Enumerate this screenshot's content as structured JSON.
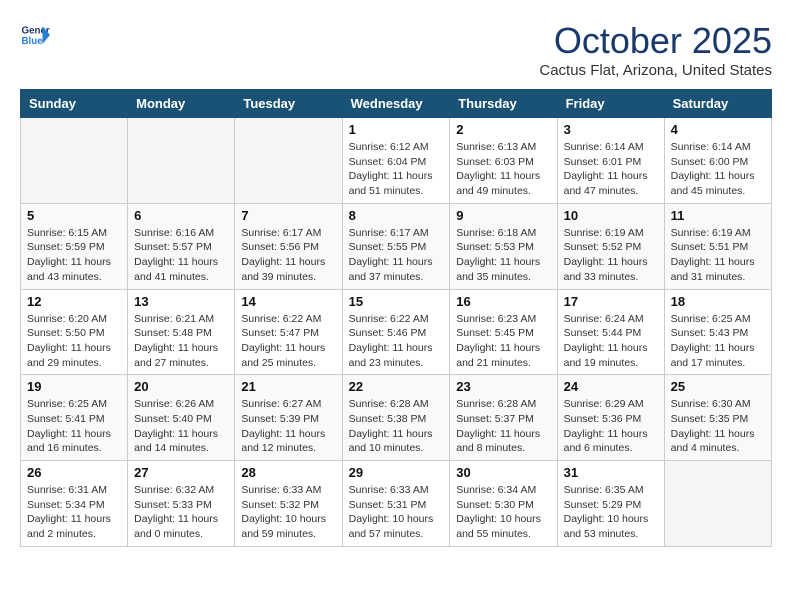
{
  "header": {
    "logo_line1": "General",
    "logo_line2": "Blue",
    "month": "October 2025",
    "location": "Cactus Flat, Arizona, United States"
  },
  "days_of_week": [
    "Sunday",
    "Monday",
    "Tuesday",
    "Wednesday",
    "Thursday",
    "Friday",
    "Saturday"
  ],
  "weeks": [
    [
      {
        "day": "",
        "sunrise": "",
        "sunset": "",
        "daylight": ""
      },
      {
        "day": "",
        "sunrise": "",
        "sunset": "",
        "daylight": ""
      },
      {
        "day": "",
        "sunrise": "",
        "sunset": "",
        "daylight": ""
      },
      {
        "day": "1",
        "sunrise": "Sunrise: 6:12 AM",
        "sunset": "Sunset: 6:04 PM",
        "daylight": "Daylight: 11 hours and 51 minutes."
      },
      {
        "day": "2",
        "sunrise": "Sunrise: 6:13 AM",
        "sunset": "Sunset: 6:03 PM",
        "daylight": "Daylight: 11 hours and 49 minutes."
      },
      {
        "day": "3",
        "sunrise": "Sunrise: 6:14 AM",
        "sunset": "Sunset: 6:01 PM",
        "daylight": "Daylight: 11 hours and 47 minutes."
      },
      {
        "day": "4",
        "sunrise": "Sunrise: 6:14 AM",
        "sunset": "Sunset: 6:00 PM",
        "daylight": "Daylight: 11 hours and 45 minutes."
      }
    ],
    [
      {
        "day": "5",
        "sunrise": "Sunrise: 6:15 AM",
        "sunset": "Sunset: 5:59 PM",
        "daylight": "Daylight: 11 hours and 43 minutes."
      },
      {
        "day": "6",
        "sunrise": "Sunrise: 6:16 AM",
        "sunset": "Sunset: 5:57 PM",
        "daylight": "Daylight: 11 hours and 41 minutes."
      },
      {
        "day": "7",
        "sunrise": "Sunrise: 6:17 AM",
        "sunset": "Sunset: 5:56 PM",
        "daylight": "Daylight: 11 hours and 39 minutes."
      },
      {
        "day": "8",
        "sunrise": "Sunrise: 6:17 AM",
        "sunset": "Sunset: 5:55 PM",
        "daylight": "Daylight: 11 hours and 37 minutes."
      },
      {
        "day": "9",
        "sunrise": "Sunrise: 6:18 AM",
        "sunset": "Sunset: 5:53 PM",
        "daylight": "Daylight: 11 hours and 35 minutes."
      },
      {
        "day": "10",
        "sunrise": "Sunrise: 6:19 AM",
        "sunset": "Sunset: 5:52 PM",
        "daylight": "Daylight: 11 hours and 33 minutes."
      },
      {
        "day": "11",
        "sunrise": "Sunrise: 6:19 AM",
        "sunset": "Sunset: 5:51 PM",
        "daylight": "Daylight: 11 hours and 31 minutes."
      }
    ],
    [
      {
        "day": "12",
        "sunrise": "Sunrise: 6:20 AM",
        "sunset": "Sunset: 5:50 PM",
        "daylight": "Daylight: 11 hours and 29 minutes."
      },
      {
        "day": "13",
        "sunrise": "Sunrise: 6:21 AM",
        "sunset": "Sunset: 5:48 PM",
        "daylight": "Daylight: 11 hours and 27 minutes."
      },
      {
        "day": "14",
        "sunrise": "Sunrise: 6:22 AM",
        "sunset": "Sunset: 5:47 PM",
        "daylight": "Daylight: 11 hours and 25 minutes."
      },
      {
        "day": "15",
        "sunrise": "Sunrise: 6:22 AM",
        "sunset": "Sunset: 5:46 PM",
        "daylight": "Daylight: 11 hours and 23 minutes."
      },
      {
        "day": "16",
        "sunrise": "Sunrise: 6:23 AM",
        "sunset": "Sunset: 5:45 PM",
        "daylight": "Daylight: 11 hours and 21 minutes."
      },
      {
        "day": "17",
        "sunrise": "Sunrise: 6:24 AM",
        "sunset": "Sunset: 5:44 PM",
        "daylight": "Daylight: 11 hours and 19 minutes."
      },
      {
        "day": "18",
        "sunrise": "Sunrise: 6:25 AM",
        "sunset": "Sunset: 5:43 PM",
        "daylight": "Daylight: 11 hours and 17 minutes."
      }
    ],
    [
      {
        "day": "19",
        "sunrise": "Sunrise: 6:25 AM",
        "sunset": "Sunset: 5:41 PM",
        "daylight": "Daylight: 11 hours and 16 minutes."
      },
      {
        "day": "20",
        "sunrise": "Sunrise: 6:26 AM",
        "sunset": "Sunset: 5:40 PM",
        "daylight": "Daylight: 11 hours and 14 minutes."
      },
      {
        "day": "21",
        "sunrise": "Sunrise: 6:27 AM",
        "sunset": "Sunset: 5:39 PM",
        "daylight": "Daylight: 11 hours and 12 minutes."
      },
      {
        "day": "22",
        "sunrise": "Sunrise: 6:28 AM",
        "sunset": "Sunset: 5:38 PM",
        "daylight": "Daylight: 11 hours and 10 minutes."
      },
      {
        "day": "23",
        "sunrise": "Sunrise: 6:28 AM",
        "sunset": "Sunset: 5:37 PM",
        "daylight": "Daylight: 11 hours and 8 minutes."
      },
      {
        "day": "24",
        "sunrise": "Sunrise: 6:29 AM",
        "sunset": "Sunset: 5:36 PM",
        "daylight": "Daylight: 11 hours and 6 minutes."
      },
      {
        "day": "25",
        "sunrise": "Sunrise: 6:30 AM",
        "sunset": "Sunset: 5:35 PM",
        "daylight": "Daylight: 11 hours and 4 minutes."
      }
    ],
    [
      {
        "day": "26",
        "sunrise": "Sunrise: 6:31 AM",
        "sunset": "Sunset: 5:34 PM",
        "daylight": "Daylight: 11 hours and 2 minutes."
      },
      {
        "day": "27",
        "sunrise": "Sunrise: 6:32 AM",
        "sunset": "Sunset: 5:33 PM",
        "daylight": "Daylight: 11 hours and 0 minutes."
      },
      {
        "day": "28",
        "sunrise": "Sunrise: 6:33 AM",
        "sunset": "Sunset: 5:32 PM",
        "daylight": "Daylight: 10 hours and 59 minutes."
      },
      {
        "day": "29",
        "sunrise": "Sunrise: 6:33 AM",
        "sunset": "Sunset: 5:31 PM",
        "daylight": "Daylight: 10 hours and 57 minutes."
      },
      {
        "day": "30",
        "sunrise": "Sunrise: 6:34 AM",
        "sunset": "Sunset: 5:30 PM",
        "daylight": "Daylight: 10 hours and 55 minutes."
      },
      {
        "day": "31",
        "sunrise": "Sunrise: 6:35 AM",
        "sunset": "Sunset: 5:29 PM",
        "daylight": "Daylight: 10 hours and 53 minutes."
      },
      {
        "day": "",
        "sunrise": "",
        "sunset": "",
        "daylight": ""
      }
    ]
  ]
}
